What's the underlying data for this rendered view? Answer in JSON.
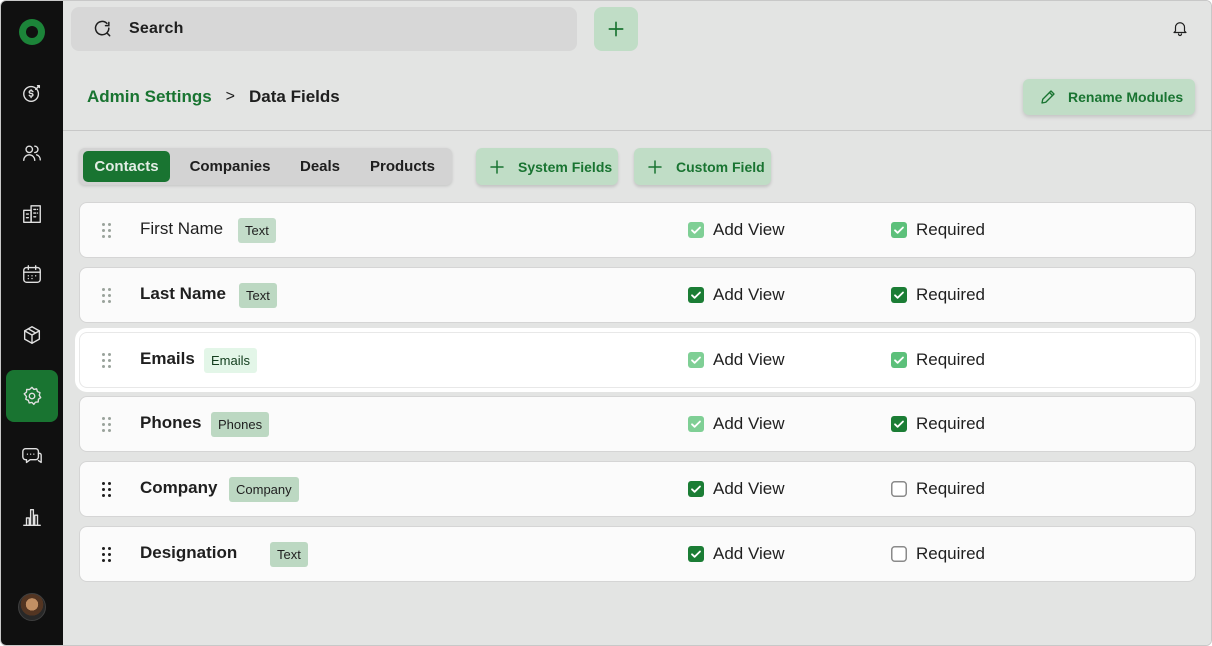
{
  "search": {
    "placeholder": "Search"
  },
  "breadcrumb": {
    "parent": "Admin Settings",
    "separator": ">",
    "current": "Data Fields"
  },
  "rename_button": "Rename Modules",
  "tabs": [
    {
      "label": "Contacts",
      "active": true
    },
    {
      "label": "Companies",
      "active": false
    },
    {
      "label": "Deals",
      "active": false
    },
    {
      "label": "Products",
      "active": false
    }
  ],
  "actions": {
    "system_fields": "System Fields",
    "custom_field": "Custom Field"
  },
  "fields": [
    {
      "name": "First Name",
      "type": "Text",
      "add_view": true,
      "required": true
    },
    {
      "name": "Last Name",
      "type": "Text",
      "add_view": true,
      "required": true
    },
    {
      "name": "Emails",
      "type": "Emails",
      "add_view": true,
      "required": true
    },
    {
      "name": "Phones",
      "type": "Phones",
      "add_view": true,
      "required": true
    },
    {
      "name": "Company",
      "type": "Company",
      "add_view": true,
      "required": false
    },
    {
      "name": "Designation",
      "type": "Text",
      "add_view": true,
      "required": false
    }
  ],
  "labels": {
    "add_view": "Add View",
    "required": "Required"
  },
  "colors": {
    "brand": "#1b7d35",
    "sidebar": "#121212",
    "badge_bg": "#cfeed6"
  }
}
